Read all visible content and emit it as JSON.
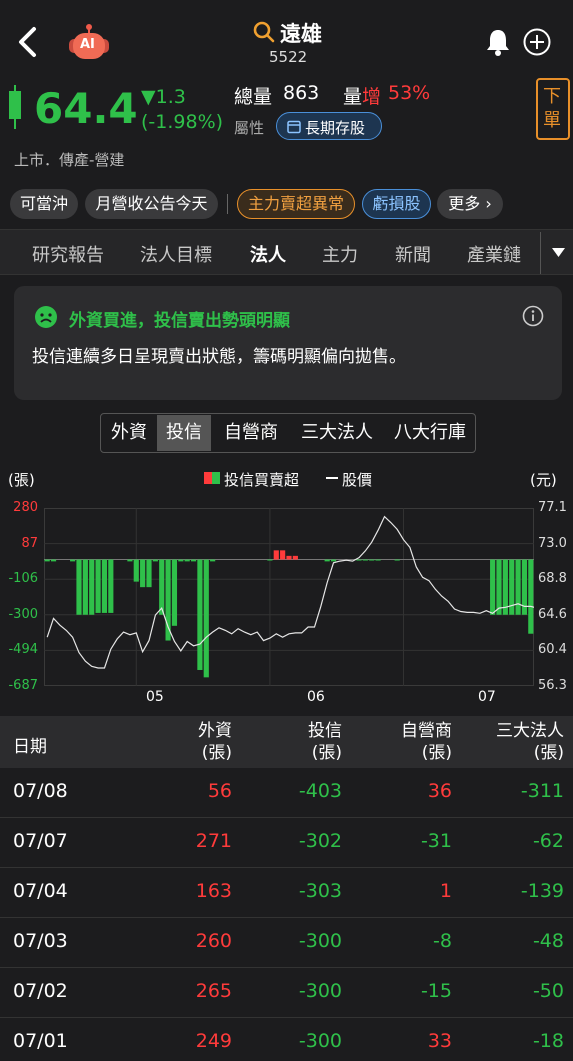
{
  "header": {
    "name": "遠雄",
    "code": "5522",
    "back_icon": "chevron-left-icon",
    "ai_badge": "AI"
  },
  "quote": {
    "price": "64.4",
    "change": "▼1.3",
    "change_pct": "(-1.98%)",
    "total_volume_label": "總量",
    "total_volume": "863",
    "volume_label_a": "量",
    "volume_label_b": "增",
    "volume_change": "53%",
    "attr_label": "屬性",
    "attr_tag": "長期存股",
    "order_button": "下單",
    "market": "上市．傳產-營建"
  },
  "chips": [
    "可當沖",
    "月營收公告今天",
    "主力賣超異常",
    "虧損股",
    "更多 ›"
  ],
  "tabs": [
    "研究報告",
    "法人目標",
    "法人",
    "主力",
    "新聞",
    "產業鏈"
  ],
  "active_tab": "法人",
  "alert": {
    "title": "外資買進，投信賣出勢頭明顯",
    "body": "投信連續多日呈現賣出狀態，籌碼明顯偏向拋售。"
  },
  "segments": [
    "外資",
    "投信",
    "自營商",
    "三大法人",
    "八大行庫"
  ],
  "active_segment": "投信",
  "colors": {
    "up": "#ff3b3b",
    "down": "#2fc04a",
    "background": "#1c1c1e"
  },
  "chart_data": {
    "type": "bar",
    "left_unit": "(張)",
    "right_unit": "(元)",
    "legend_bar": "投信買賣超",
    "legend_line": "股價",
    "y_left_ticks": [
      "280",
      "87",
      "-106",
      "-300",
      "-494",
      "-687"
    ],
    "y_right_ticks": [
      "77.1",
      "73.0",
      "68.8",
      "64.6",
      "60.4",
      "56.3"
    ],
    "ylim_left": [
      -687,
      280
    ],
    "ylim_right": [
      56.3,
      77.1
    ],
    "x_month_labels": [
      {
        "label": "05",
        "index": 14
      },
      {
        "label": "06",
        "index": 35
      },
      {
        "label": "07",
        "index": 56
      }
    ],
    "grid": true,
    "values": [
      -10,
      -10,
      0,
      0,
      -10,
      -300,
      -300,
      -300,
      -290,
      -290,
      -290,
      0,
      0,
      -10,
      -120,
      -150,
      -150,
      -10,
      -300,
      -440,
      -360,
      -10,
      -10,
      -10,
      -600,
      -640,
      -10,
      0,
      0,
      0,
      0,
      0,
      0,
      0,
      0,
      -5,
      50,
      50,
      20,
      20,
      0,
      0,
      0,
      0,
      -10,
      -10,
      0,
      0,
      0,
      -5,
      -5,
      -5,
      -5,
      0,
      0,
      -5,
      0,
      0,
      0,
      0,
      0,
      0,
      0,
      0,
      0,
      0,
      0,
      0,
      0,
      0,
      -300,
      -300,
      -300,
      -300,
      -300,
      -300,
      -403
    ],
    "price": [
      62.0,
      64.2,
      63.4,
      62.8,
      62.0,
      60.2,
      59.2,
      58.6,
      58.4,
      58.4,
      60.6,
      61.8,
      62.6,
      62.3,
      62.5,
      60.3,
      61.6,
      64.6,
      65.4,
      63.2,
      61.5,
      60.4,
      61.5,
      61.0,
      61.2,
      62.0,
      62.6,
      63.1,
      62.8,
      62.4,
      63.0,
      62.6,
      62.3,
      62.6,
      61.6,
      61.9,
      62.4,
      62.0,
      62.4,
      62.5,
      62.5,
      63.2,
      63.2,
      65.6,
      68.4,
      70.7,
      70.9,
      71.0,
      70.9,
      71.3,
      72.1,
      73.1,
      74.5,
      76.1,
      75.4,
      74.6,
      73.4,
      72.5,
      70.2,
      69.0,
      68.6,
      67.6,
      66.8,
      66.2,
      65.3,
      65.0,
      64.9,
      64.9,
      64.8,
      65.1,
      64.8,
      65.4,
      65.5,
      65.7,
      65.9,
      65.6,
      65.6,
      65.4
    ],
    "dates_note": ""
  },
  "table": {
    "headers": [
      "日期",
      "外資\n(張)",
      "投信\n(張)",
      "自營商\n(張)",
      "三大法人\n(張)"
    ],
    "rows": [
      [
        "07/08",
        "56",
        "-403",
        "36",
        "-311"
      ],
      [
        "07/07",
        "271",
        "-302",
        "-31",
        "-62"
      ],
      [
        "07/04",
        "163",
        "-303",
        "1",
        "-139"
      ],
      [
        "07/03",
        "260",
        "-300",
        "-8",
        "-48"
      ],
      [
        "07/02",
        "265",
        "-300",
        "-15",
        "-50"
      ],
      [
        "07/01",
        "249",
        "-300",
        "33",
        "-18"
      ]
    ]
  }
}
